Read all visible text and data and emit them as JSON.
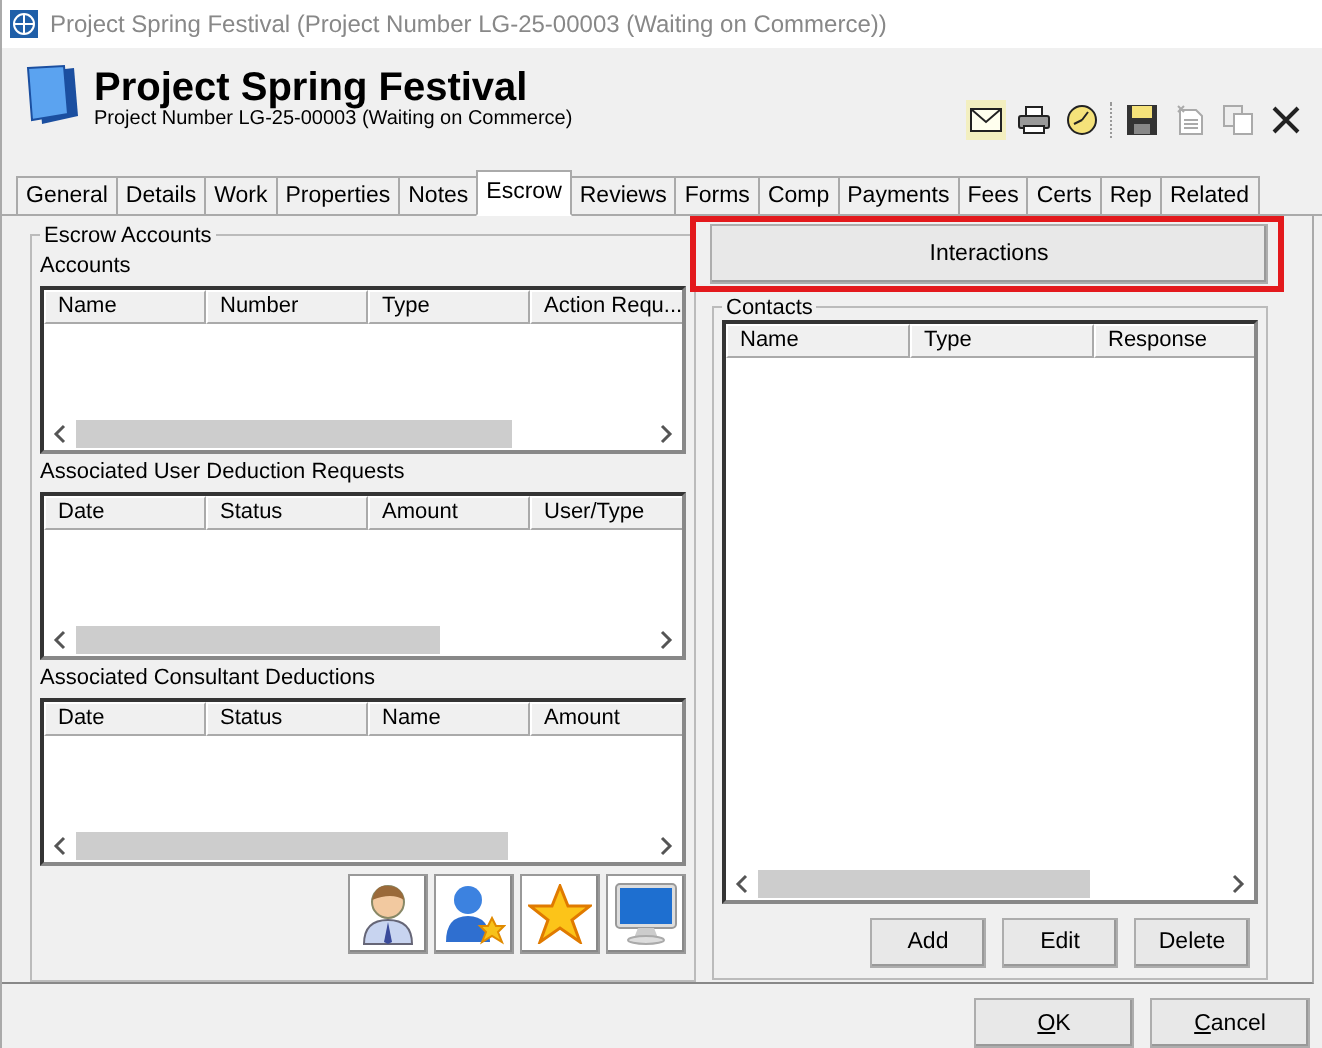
{
  "window": {
    "title": "Project Spring Festival (Project Number LG-25-00003 (Waiting on Commerce))"
  },
  "header": {
    "title": "Project Spring Festival",
    "subtitle": "Project Number LG-25-00003 (Waiting on Commerce)"
  },
  "toolbar": [
    {
      "kind": "mail",
      "disabled": false,
      "selected": true
    },
    {
      "kind": "print",
      "disabled": false,
      "selected": false
    },
    {
      "kind": "clock",
      "disabled": false,
      "selected": false
    },
    {
      "kind": "separator"
    },
    {
      "kind": "save",
      "disabled": false,
      "selected": false
    },
    {
      "kind": "new-doc",
      "disabled": true,
      "selected": false
    },
    {
      "kind": "copy",
      "disabled": true,
      "selected": false
    },
    {
      "kind": "close",
      "disabled": false,
      "selected": false
    }
  ],
  "tabs": [
    {
      "label": "General",
      "selected": false
    },
    {
      "label": "Details",
      "selected": false
    },
    {
      "label": "Work",
      "selected": false
    },
    {
      "label": "Properties",
      "selected": false
    },
    {
      "label": "Notes",
      "selected": false
    },
    {
      "label": "Escrow",
      "selected": true
    },
    {
      "label": "Reviews",
      "selected": false
    },
    {
      "label": "Forms",
      "selected": false
    },
    {
      "label": "Comp",
      "selected": false
    },
    {
      "label": "Payments",
      "selected": false
    },
    {
      "label": "Fees",
      "selected": false
    },
    {
      "label": "Certs",
      "selected": false
    },
    {
      "label": "Rep",
      "selected": false
    },
    {
      "label": "Related",
      "selected": false
    }
  ],
  "escrow_accounts": {
    "title": "Escrow Accounts",
    "tables": [
      {
        "label": "Accounts",
        "columns": [
          "Name",
          "Number",
          "Type",
          "Action Requ..."
        ]
      },
      {
        "label": "Associated User Deduction Requests",
        "columns": [
          "Date",
          "Status",
          "Amount",
          "User/Type"
        ]
      },
      {
        "label": "Associated Consultant Deductions",
        "columns": [
          "Date",
          "Status",
          "Name",
          "Amount"
        ]
      }
    ],
    "icon_buttons": [
      {
        "kind": "person"
      },
      {
        "kind": "new-user"
      },
      {
        "kind": "star"
      },
      {
        "kind": "monitor"
      }
    ]
  },
  "interactions_button": {
    "label": "Interactions",
    "highlighted": true
  },
  "contacts": {
    "title": "Contacts",
    "columns": [
      "Name",
      "Type",
      "Response"
    ],
    "buttons": [
      "Add",
      "Edit",
      "Delete"
    ]
  },
  "dialog_buttons": [
    {
      "label": "OK",
      "underline_first": true
    },
    {
      "label": "Cancel",
      "underline_first": true
    }
  ]
}
